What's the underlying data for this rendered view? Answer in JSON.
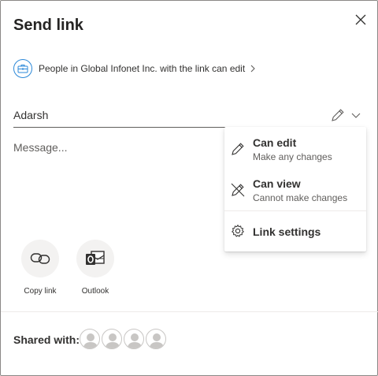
{
  "dialog": {
    "title": "Send link"
  },
  "permission_summary": "People in Global Infonet Inc. with the link can edit",
  "recipient": {
    "value": "Adarsh"
  },
  "message": {
    "placeholder": "Message..."
  },
  "permission_menu": {
    "items": [
      {
        "label": "Can edit",
        "description": "Make any changes",
        "icon": "pencil-icon"
      },
      {
        "label": "Can view",
        "description": "Cannot make changes",
        "icon": "pencil-off-icon"
      }
    ],
    "settings_label": "Link settings"
  },
  "share_options": [
    {
      "label": "Copy link",
      "icon": "link-icon"
    },
    {
      "label": "Outlook",
      "icon": "outlook-icon"
    }
  ],
  "shared_with": {
    "label": "Shared with:",
    "avatar_count": 4
  },
  "colors": {
    "accent": "#2b88d8",
    "outlook": "#323130",
    "text": "#323130"
  }
}
